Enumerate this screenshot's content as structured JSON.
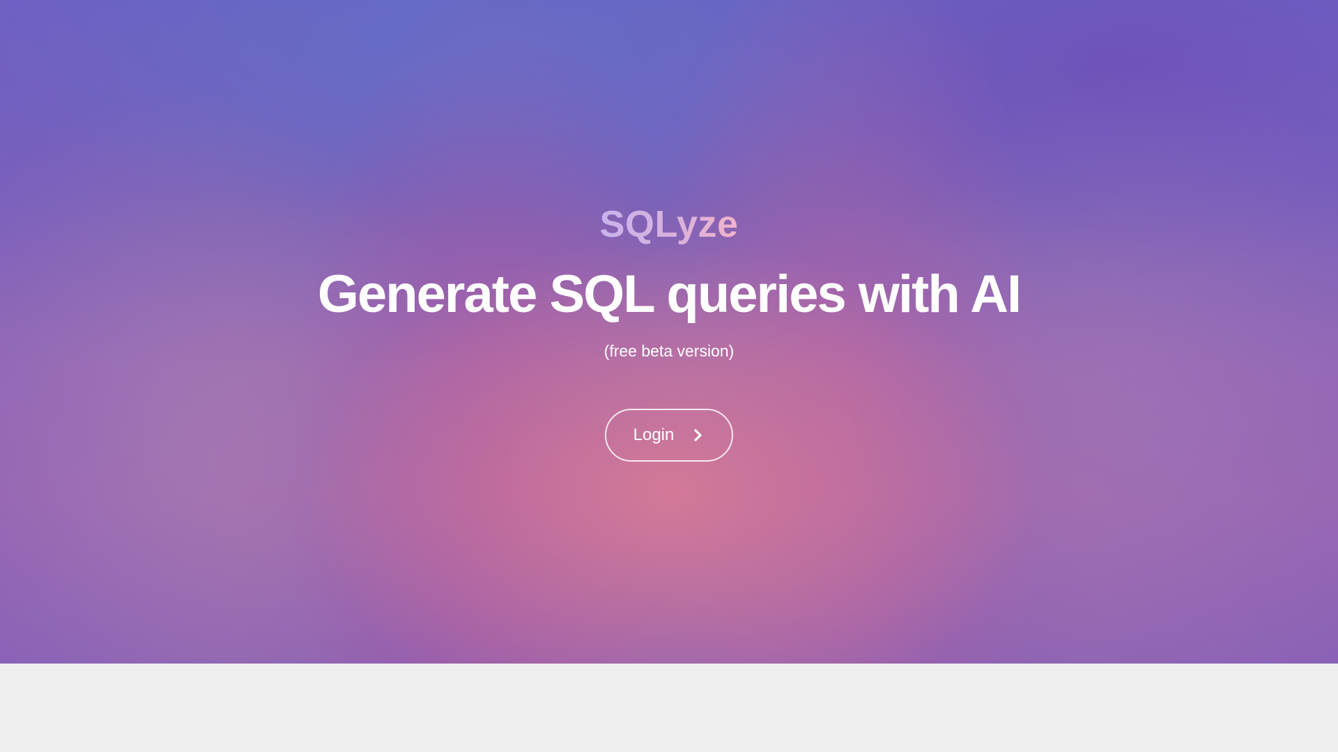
{
  "hero": {
    "brand": "SQLyze",
    "headline": "Generate SQL queries with AI",
    "subtitle": "(free beta version)",
    "login_label": "Login",
    "login_icon": "chevron-right-icon"
  },
  "colors": {
    "headline": "#ffffff",
    "brand_gradient_start": "#c9b3ec",
    "brand_gradient_end": "#f3b3c9",
    "footer_background": "#efefef"
  }
}
